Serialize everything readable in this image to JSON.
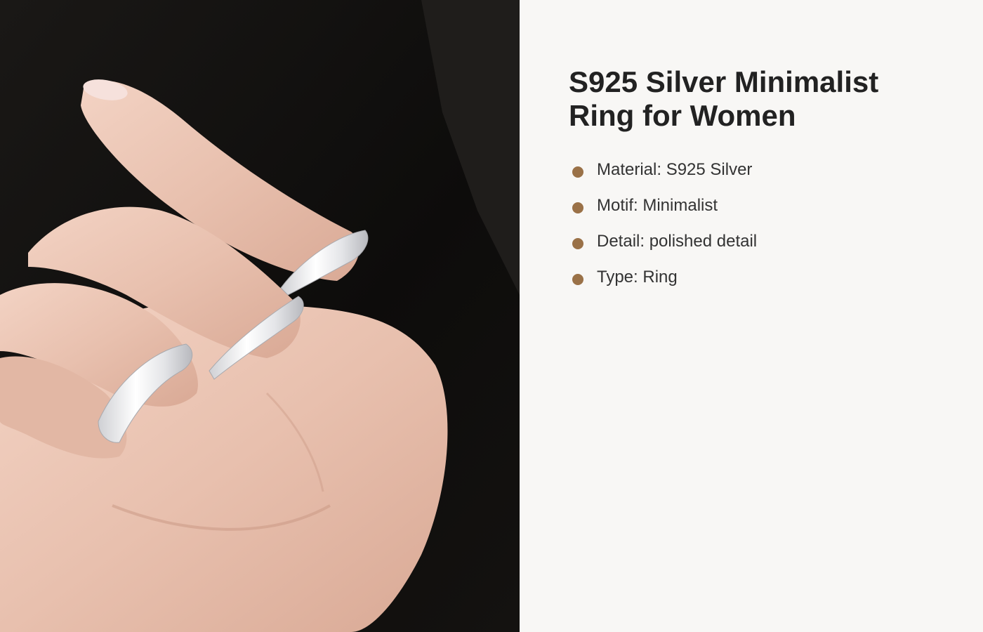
{
  "product": {
    "title_line1": "S925 Silver Minimalist",
    "title_line2": "Ring for Women",
    "image_description_icon": "product-photo",
    "bullet_color": "#9a7147",
    "specs": [
      {
        "text": "Material: S925 Silver"
      },
      {
        "text": "Motif: Minimalist"
      },
      {
        "text": "Detail: polished detail"
      },
      {
        "text": "Type: Ring"
      }
    ]
  }
}
